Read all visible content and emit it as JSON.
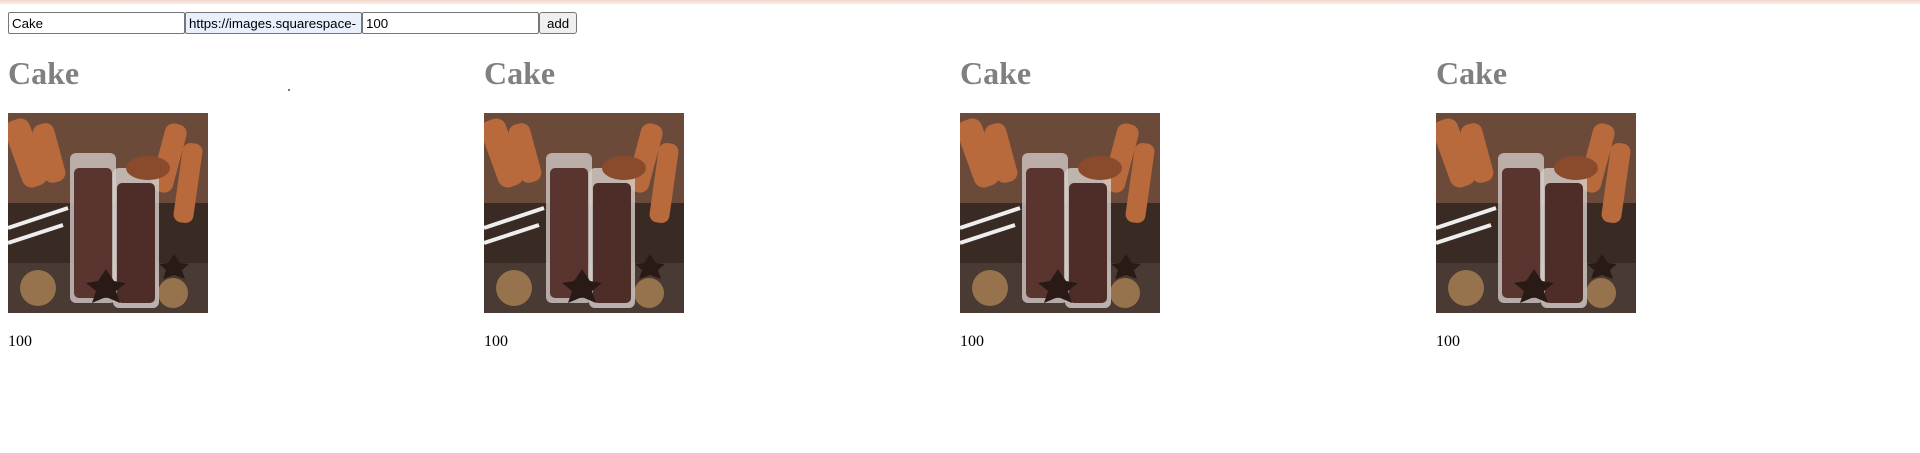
{
  "form": {
    "name_value": "Cake",
    "url_value": "https://images.squarespace-",
    "price_value": "100",
    "add_label": "add"
  },
  "products": [
    {
      "title": "Cake",
      "price": "100",
      "image_icon": "hot-chocolate-photo"
    },
    {
      "title": "Cake",
      "price": "100",
      "image_icon": "hot-chocolate-photo"
    },
    {
      "title": "Cake",
      "price": "100",
      "image_icon": "hot-chocolate-photo"
    },
    {
      "title": "Cake",
      "price": "100",
      "image_icon": "hot-chocolate-photo"
    }
  ]
}
